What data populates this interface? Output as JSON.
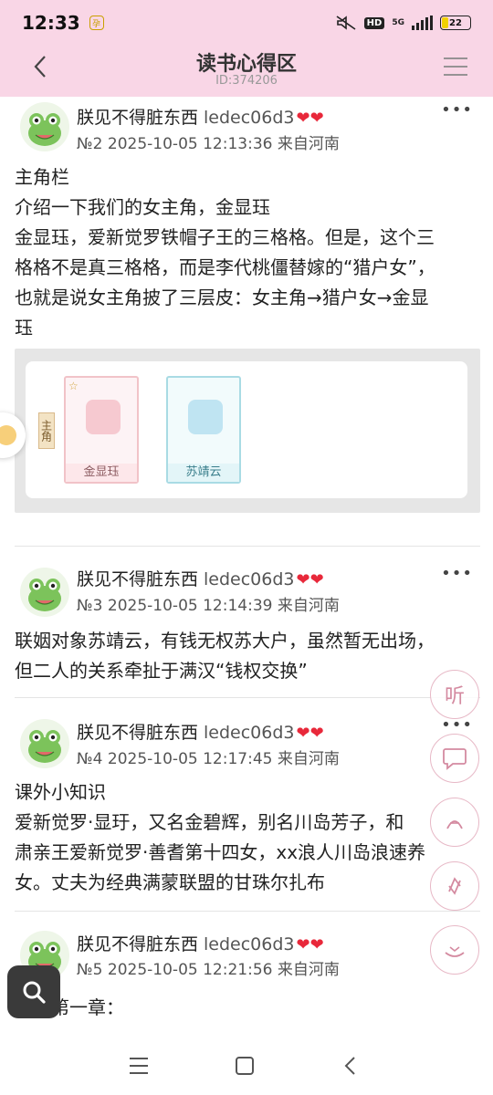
{
  "status_bar": {
    "time": "12:33",
    "app_badge": "孕",
    "network": "5G",
    "hd": "HD",
    "battery": "22",
    "battery_level": 0.22
  },
  "header": {
    "title": "读书心得区",
    "subtitle": "ID:374206"
  },
  "posts": [
    {
      "user": "朕见不得脏东西",
      "uid": "ledec06d3",
      "hearts": "❤❤",
      "meta": "№2 2025-10-05 12:13:36 来自河南",
      "lines": [
        "主角栏",
        "介绍一下我们的女主角，金显珏",
        "金显珏，爱新觉罗铁帽子王的三格格。但是，这个三",
        "格格不是真三格格，而是李代桃僵替嫁的“猎户女”，",
        "也就是说女主角披了三层皮：女主角→猎户女→金显",
        "珏"
      ],
      "card": {
        "role_label": "主角",
        "characters": [
          {
            "name": "金显珏",
            "style": "pink"
          },
          {
            "name": "苏靖云",
            "style": "blue"
          }
        ]
      }
    },
    {
      "user": "朕见不得脏东西",
      "uid": "ledec06d3",
      "hearts": "❤❤",
      "meta": "№3 2025-10-05 12:14:39 来自河南",
      "lines": [
        "联姻对象苏靖云，有钱无权苏大户，虽然暂无出场，",
        "但二人的关系牵扯于满汉“钱权交换”"
      ]
    },
    {
      "user": "朕见不得脏东西",
      "uid": "ledec06d3",
      "hearts": "❤❤",
      "meta": "№4 2025-10-05 12:17:45 来自河南",
      "lines": [
        "课外小知识",
        "爱新觉罗·显玗，又名金碧辉，别名川岛芳子，和",
        "肃亲王爱新觉罗·善耆第十四女，xx浪人川岛浪速养",
        "女。丈夫为经典满蒙联盟的甘珠尔扎布"
      ]
    },
    {
      "user": "朕见不得脏东西",
      "uid": "ledec06d3",
      "hearts": "❤❤",
      "meta": "№5 2025-10-05 12:21:56 来自河南",
      "lines": [
        "正文第一章："
      ]
    }
  ],
  "fabs": {
    "listen": "听",
    "comment": "comment-icon",
    "follow": "follow-icon",
    "share": "share-icon",
    "reward": "reward-icon"
  },
  "colors": {
    "header_bg": "#f9d6e6",
    "heart": "#e8283a",
    "fab_border": "#e7b8c6"
  }
}
